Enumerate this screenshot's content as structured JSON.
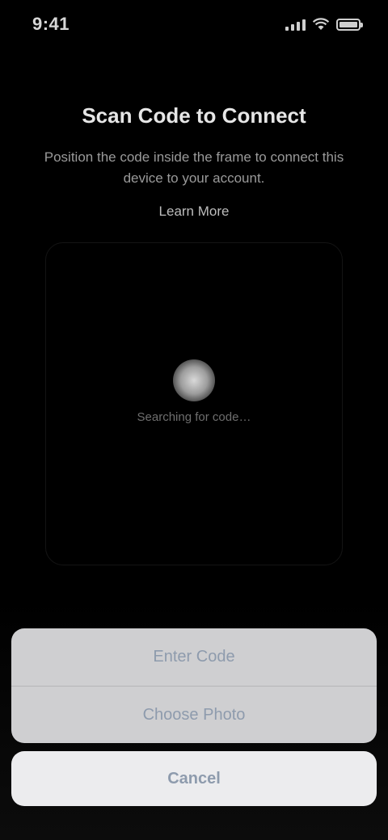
{
  "status_bar": {
    "time": "9:41",
    "signal_icon": "cellular-signal-icon",
    "wifi_icon": "wifi-icon",
    "battery_icon": "battery-icon",
    "battery_level": 1.0
  },
  "header": {
    "title": "Scan Code to Connect",
    "subtitle": "Position the code inside the frame to connect this device to your account.",
    "learn_more": "Learn More"
  },
  "viewfinder": {
    "hint": "Searching for code…"
  },
  "action_sheet": {
    "options": [
      {
        "label": "Enter Code"
      },
      {
        "label": "Choose Photo"
      }
    ],
    "cancel_label": "Cancel",
    "colors": {
      "group_bg": "#cfcfd1",
      "cancel_bg": "#ececee",
      "text": "#8e9bad"
    }
  }
}
